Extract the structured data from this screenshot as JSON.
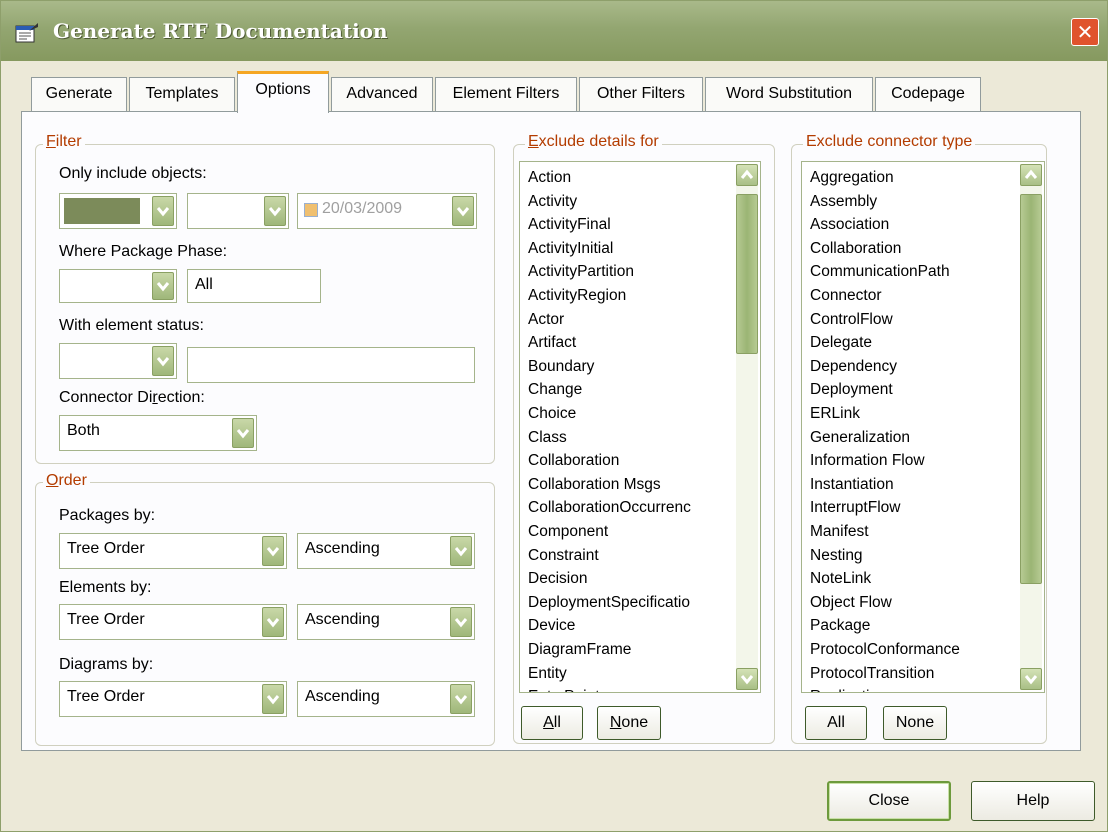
{
  "window": {
    "title": "Generate RTF Documentation"
  },
  "tabs": [
    {
      "label": "Generate"
    },
    {
      "label": "Templates"
    },
    {
      "label": "Options"
    },
    {
      "label": "Advanced"
    },
    {
      "label": "Element Filters"
    },
    {
      "label": "Other Filters"
    },
    {
      "label": "Word Substitution"
    },
    {
      "label": "Codepage"
    }
  ],
  "active_tab": "Options",
  "filter": {
    "legend_rest": "ilter",
    "legend_key": "F",
    "only_include_label": "Only include objects:",
    "only_include_value1": "",
    "only_include_value2": "",
    "date_value": "20/03/2009",
    "package_phase_label": "Where Package Phase:",
    "package_phase_op": "",
    "package_phase_value": "All",
    "element_status_label": "With element status:",
    "element_status_op": "",
    "element_status_value": "",
    "connector_direction_label_pre": "Connector Di",
    "connector_direction_label_key": "r",
    "connector_direction_label_post": "ection:",
    "connector_direction_value": "Both"
  },
  "order": {
    "legend_key": "O",
    "legend_rest": "rder",
    "packages_label": "Packages by:",
    "packages_order": "Tree Order",
    "packages_dir": "Ascending",
    "elements_label": "Elements by:",
    "elements_order": "Tree Order",
    "elements_dir": "Ascending",
    "diagrams_label": "Diagrams by:",
    "diagrams_order": "Tree Order",
    "diagrams_dir": "Ascending"
  },
  "exclude_details": {
    "legend_key": "E",
    "legend_rest": "xclude details for",
    "items": [
      "Action",
      "Activity",
      "ActivityFinal",
      "ActivityInitial",
      "ActivityPartition",
      "ActivityRegion",
      "Actor",
      "Artifact",
      "Boundary",
      "Change",
      "Choice",
      "Class",
      "Collaboration",
      "Collaboration Msgs",
      "CollaborationOccurrenc",
      "Component",
      "Constraint",
      "Decision",
      "DeploymentSpecificatio",
      "Device",
      "DiagramFrame",
      "Entity",
      "EntryPoint"
    ],
    "all_key": "A",
    "all_rest": "ll",
    "none_key": "N",
    "none_rest": "one"
  },
  "exclude_connector": {
    "legend": "Exclude connector type",
    "items": [
      "Aggregation",
      "Assembly",
      "Association",
      "Collaboration",
      "CommunicationPath",
      "Connector",
      "ControlFlow",
      "Delegate",
      "Dependency",
      "Deployment",
      "ERLink",
      "Generalization",
      "Information Flow",
      "Instantiation",
      "InterruptFlow",
      "Manifest",
      "Nesting",
      "NoteLink",
      "Object Flow",
      "Package",
      "ProtocolConformance",
      "ProtocolTransition",
      "Realization"
    ],
    "all_label": "All",
    "none_label": "None"
  },
  "footer": {
    "close_label": "Close",
    "help_label": "Help"
  },
  "colors": {
    "legend": "#b33c00",
    "title_bar": "#93a671",
    "accent_tab": "#f5a623",
    "close_x": "#e0532d"
  }
}
